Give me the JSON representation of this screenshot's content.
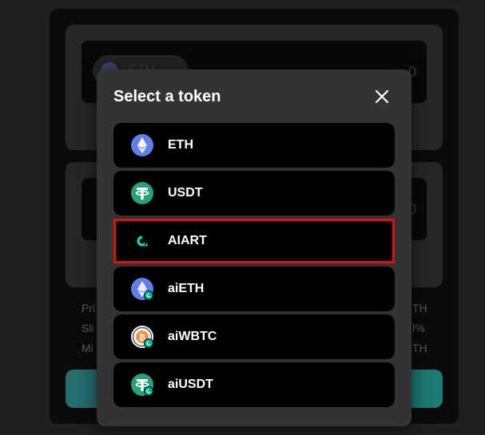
{
  "background": {
    "pill_token": "ETH",
    "amount_top": "0",
    "amount_bottom": "0",
    "info_labels": [
      "Pri",
      "Sli",
      "Mi"
    ],
    "info_values": [
      "TH",
      "l%",
      "TH"
    ]
  },
  "modal": {
    "title": "Select a token",
    "close_icon": "close-icon"
  },
  "tokens": [
    {
      "symbol": "ETH",
      "icon": "eth-icon",
      "color": "#627eea",
      "selected": false
    },
    {
      "symbol": "USDT",
      "icon": "usdt-icon",
      "color": "#26a17b",
      "selected": false
    },
    {
      "symbol": "AIART",
      "icon": "aiart-icon",
      "color": "#00e0b8",
      "selected": true
    },
    {
      "symbol": "aiETH",
      "icon": "aieth-icon",
      "color": "#627eea",
      "selected": false
    },
    {
      "symbol": "aiWBTC",
      "icon": "aiwbtc-icon",
      "color": "#f09242",
      "selected": false
    },
    {
      "symbol": "aiUSDT",
      "icon": "aiusdt-icon",
      "color": "#26a17b",
      "selected": false
    }
  ],
  "colors": {
    "highlight_border": "#e01010",
    "modal_bg": "#333333",
    "row_bg": "#000000",
    "accent_teal": "#1f8f86"
  }
}
